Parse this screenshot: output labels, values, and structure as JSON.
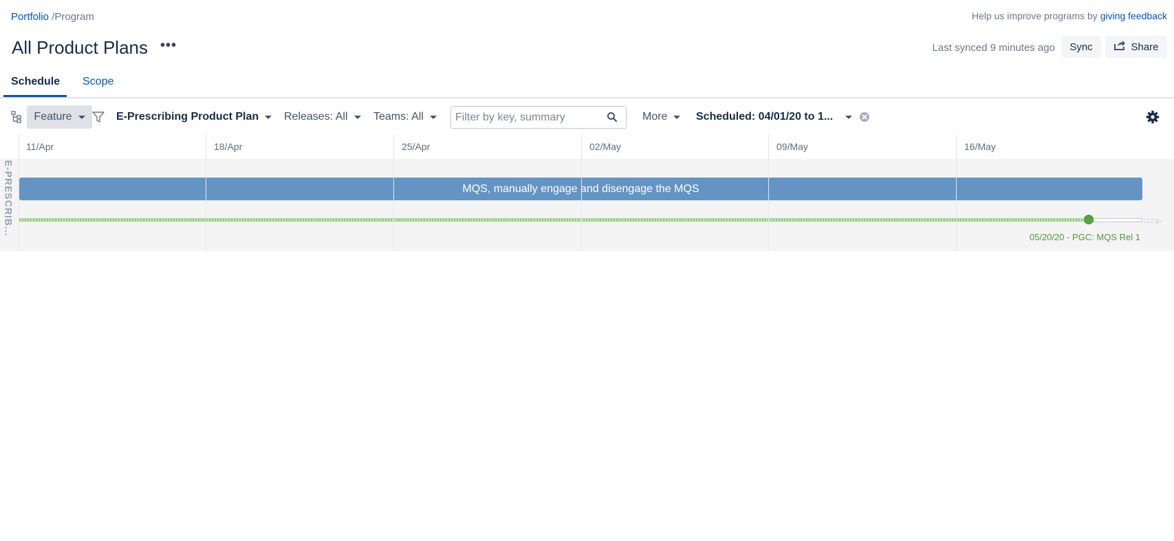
{
  "breadcrumb": {
    "parent": "Portfolio",
    "separator": " /",
    "current": "Program"
  },
  "feedback": {
    "text": "Help us improve programs by ",
    "link": "giving feedback"
  },
  "header": {
    "title": "All Product Plans",
    "more_label": "•••",
    "last_synced": "Last synced 9 minutes ago",
    "sync_label": "Sync",
    "share_label": "Share"
  },
  "tabs": [
    {
      "label": "Schedule",
      "active": true
    },
    {
      "label": "Scope",
      "active": false
    }
  ],
  "toolbar": {
    "hierarchy_level": "Feature",
    "plan": "E-Prescribing Product Plan",
    "releases": "Releases: All",
    "teams": "Teams: All",
    "search": {
      "placeholder": "Filter by key, summary",
      "value": ""
    },
    "more": "More",
    "scheduled": "Scheduled: 04/01/20 to 1..."
  },
  "timeline": {
    "weeks": [
      "11/Apr",
      "18/Apr",
      "25/Apr",
      "02/May",
      "09/May",
      "16/May"
    ],
    "lane_label": "E-PRESCRIB...",
    "issue": "MQS, manually engage and disengage the MQS",
    "release_label": "05/20/20 - PGC: MQS Rel 1"
  },
  "colors": {
    "accent": "#0052cc",
    "issue_bar": "#6494c4",
    "release_green": "#5aa449",
    "lane_bg": "#f4f4f4"
  },
  "icons": [
    "hierarchy-icon",
    "filter-icon",
    "search-icon",
    "clear-icon",
    "gear-icon",
    "share-icon"
  ]
}
